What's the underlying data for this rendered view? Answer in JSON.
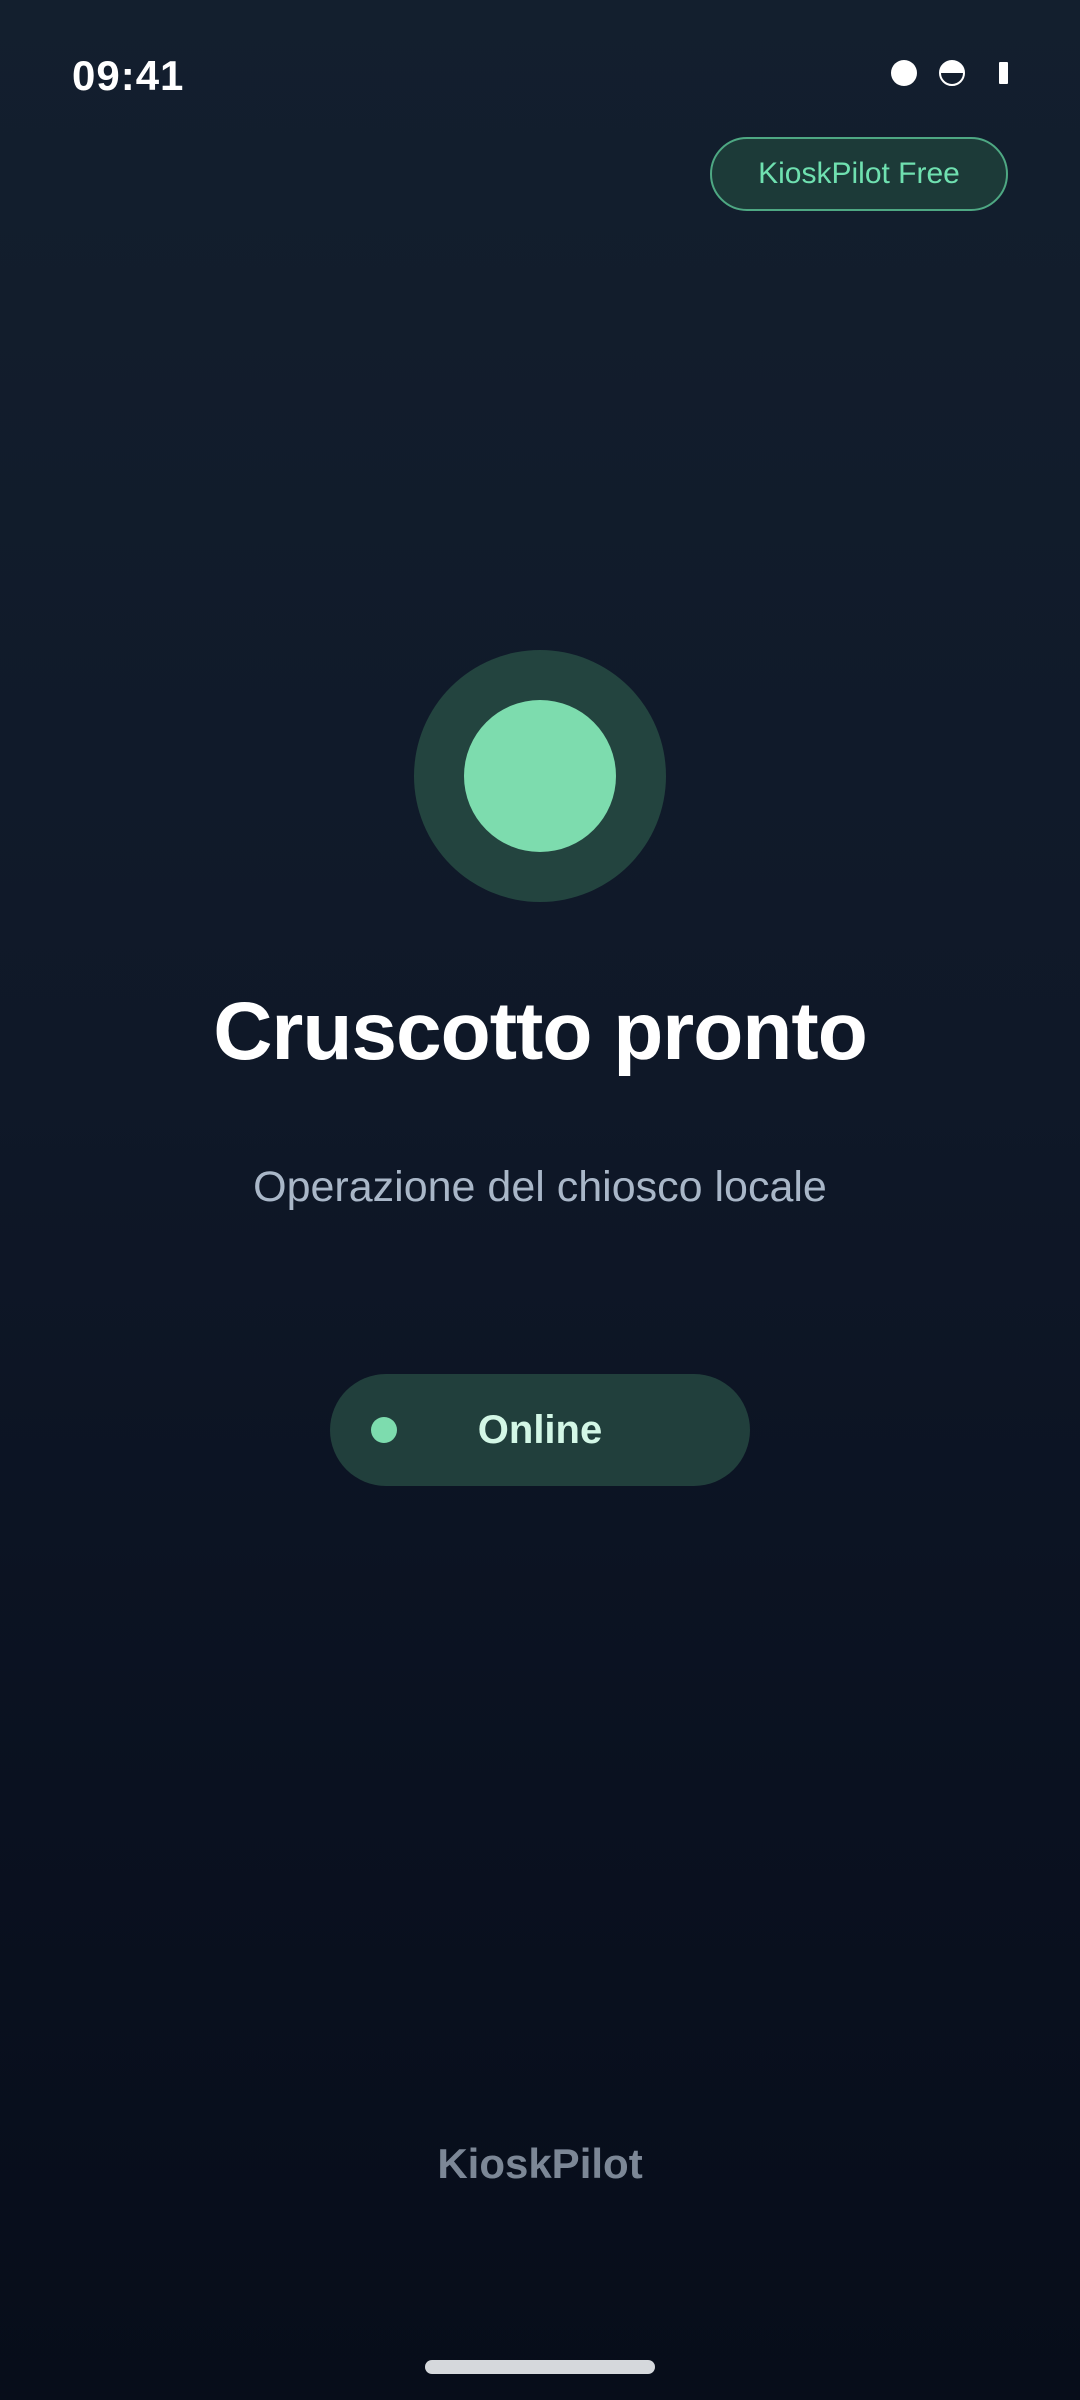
{
  "status_bar": {
    "time": "09:41",
    "icons": [
      "signal-dot-icon",
      "wifi-half-icon",
      "battery-icon"
    ]
  },
  "plan_badge": {
    "label": "KioskPilot Free"
  },
  "status_orb": {
    "icon": "status-orb-icon",
    "color": "#7ddcae"
  },
  "main": {
    "title": "Cruscotto pronto",
    "subtitle": "Operazione del chiosco locale"
  },
  "connection": {
    "label": "Online",
    "indicator_color": "#7ddcae"
  },
  "footer": {
    "brand": "KioskPilot"
  },
  "colors": {
    "accent": "#7ddcae",
    "background_top": "#131f2e",
    "background_bottom": "#070d1a"
  }
}
